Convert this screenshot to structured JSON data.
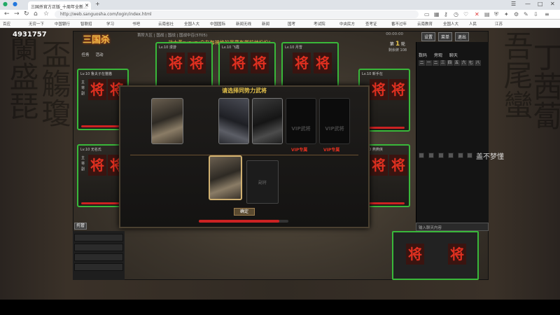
{
  "browser": {
    "tab_title": "三国杀官方正版_十周年全新…",
    "url": "http://web.sanguosha.com/login/index.html",
    "bookmarks": [
      "百应",
      "无穷一下",
      "中国银行",
      "智联招",
      "学习",
      "书吧",
      "云南省社",
      "全国人大",
      "中国国际",
      "新闻无线",
      "新闻",
      "国考",
      "考试院",
      "中央民方",
      "查考证",
      "番不过年",
      "云南教育",
      "全国人大",
      "人民",
      "江苏"
    ],
    "window_controls": [
      "☰",
      "—",
      "□",
      "✕"
    ]
  },
  "game": {
    "user_id": "4931757",
    "logo": "三国杀",
    "top_info": "首阶大区 | 国战 | 国战 | 国战中召(5T05)",
    "clock": "00:00:00",
    "marquee": "战士黄sunyzu白在每神格的暴露有学前地份份!",
    "side_icons": [
      "任务",
      "活动"
    ],
    "round_label": "第",
    "round_num": "1",
    "round_suffix": "轮",
    "round_sub": "剩余牌 108",
    "right_buttons": [
      "设置",
      "菜单",
      "退出"
    ],
    "right_tabs": [
      "数码",
      "旁观",
      "聊天"
    ],
    "num_row": [
      "二",
      "一",
      "二",
      "三",
      "四",
      "五",
      "六",
      "七",
      "八"
    ],
    "chat_placeholder": "输入聊天内容",
    "trust_label": "托管",
    "seats": [
      {
        "name": "Lv.10 鲁夫子在猫猫",
        "jiang": [
          "将",
          "将"
        ]
      },
      {
        "name": "Lv.10 无名氏",
        "jiang": [
          "将",
          "将"
        ]
      },
      {
        "name": "Lv.10 漫游",
        "jiang": [
          "将",
          "将"
        ]
      },
      {
        "name": "Lv.10 飞霞",
        "jiang": [
          "将",
          "将"
        ]
      },
      {
        "name": "Lv.10 月雪",
        "jiang": [
          "将",
          "将"
        ]
      },
      {
        "name": "Lv.10 新手在",
        "jiang": [
          "将",
          "将"
        ]
      },
      {
        "name": "Lv.10 燕燕侠",
        "jiang": [
          "将",
          "将"
        ]
      }
    ],
    "my_jiang": [
      "将",
      "将"
    ],
    "modal": {
      "title": "请选择同势力武将",
      "vip_locked_text": "VIP武将",
      "vip_labels": [
        "VIP专属",
        "VIP专属"
      ],
      "slot_empty_label": "副将",
      "confirm": "确定",
      "timer_progress": 0.9
    },
    "watermark": "盖不梦懂"
  },
  "colors": {
    "accent_green": "#39b83a",
    "jiang_red": "#e03020",
    "gold": "#e6c34a"
  }
}
